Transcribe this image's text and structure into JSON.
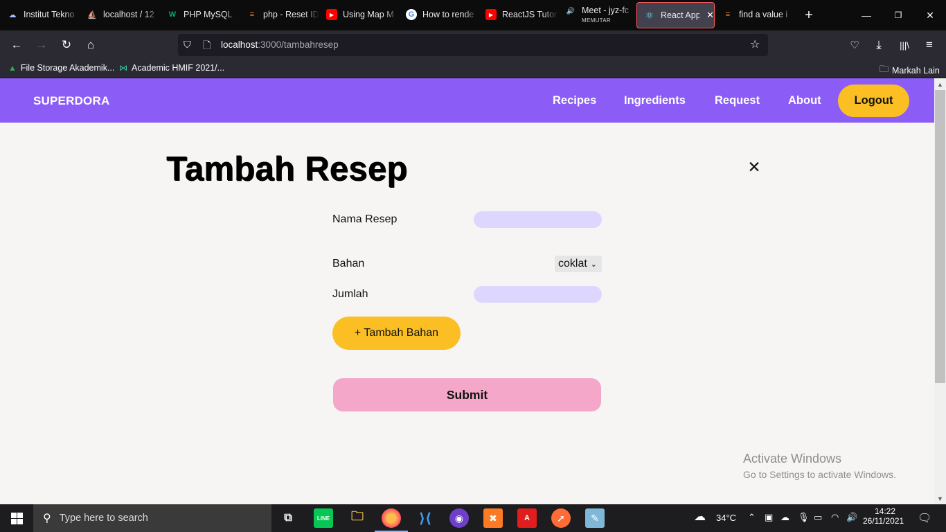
{
  "browser": {
    "tabs": [
      {
        "label": "Institut Tekno",
        "icon": "cloud-tab-icon"
      },
      {
        "label": "localhost / 12",
        "icon": "phpmyadmin-tab-icon"
      },
      {
        "label": "PHP MySQL",
        "icon": "w3schools-tab-icon"
      },
      {
        "label": "php - Reset ID",
        "icon": "stackoverflow-tab-icon"
      },
      {
        "label": "Using Map M",
        "icon": "youtube-tab-icon"
      },
      {
        "label": "How to rende",
        "icon": "google-tab-icon"
      },
      {
        "label": "ReactJS Tutor",
        "icon": "youtube-tab-icon"
      },
      {
        "label": "Meet - jyz-fc",
        "sublabel": "MEMUTAR",
        "icon": "meet-tab-icon"
      },
      {
        "label": "React App",
        "icon": "react-tab-icon",
        "active": true
      },
      {
        "label": "find a value i",
        "icon": "stackoverflow-tab-icon"
      }
    ],
    "url": {
      "host": "localhost",
      "rest": ":3000/tambahresep"
    },
    "bookmarks": [
      {
        "label": "File Storage Akademik...",
        "icon": "google-drive-icon"
      },
      {
        "label": "Academic HMIF 2021/...",
        "icon": "hmif-icon"
      }
    ],
    "other_bookmarks": "Markah Lain"
  },
  "app": {
    "brand": "SUPERDORA",
    "nav": {
      "recipes": "Recipes",
      "ingredients": "Ingredients",
      "request": "Request",
      "about": "About",
      "logout": "Logout"
    },
    "colors": {
      "header": "#8b5cf6",
      "accent": "#fbbf24",
      "input": "#ddd6fe",
      "submit": "#f4a7c8"
    }
  },
  "form": {
    "title": "Tambah Resep",
    "nama_resep_label": "Nama Resep",
    "nama_resep_value": "",
    "bahan_label": "Bahan",
    "bahan_selected": "coklat",
    "jumlah_label": "Jumlah",
    "jumlah_value": "",
    "add_bahan": "+ Tambah Bahan",
    "submit": "Submit"
  },
  "watermark": {
    "line1": "Activate Windows",
    "line2": "Go to Settings to activate Windows."
  },
  "taskbar": {
    "search_placeholder": "Type here to search",
    "temperature": "34°C",
    "time": "14:22",
    "date": "26/11/2021"
  }
}
